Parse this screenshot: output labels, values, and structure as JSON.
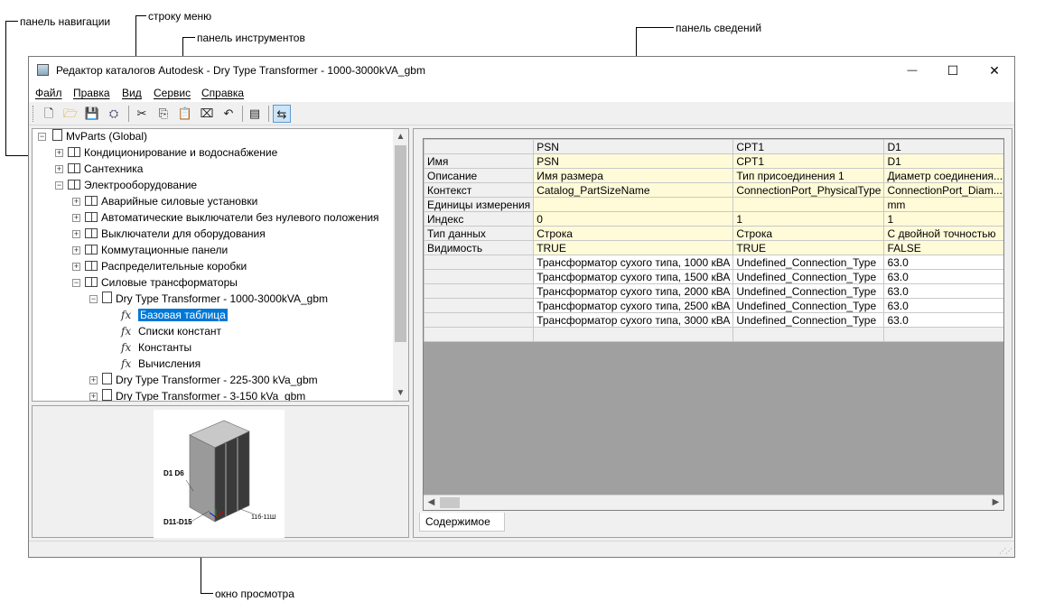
{
  "callouts": {
    "nav": "панель навигации",
    "menu": "строку меню",
    "toolbar": "панель инструментов",
    "details": "панель сведений",
    "preview": "окно просмотра"
  },
  "window": {
    "title": "Редактор каталогов Autodesk - Dry Type Transformer - 1000-3000kVA_gbm",
    "minimize": "—",
    "maximize": "☐",
    "close": "✕"
  },
  "menu": [
    "Файл",
    "Правка",
    "Вид",
    "Сервис",
    "Справка"
  ],
  "toolbar": {
    "icons": [
      "new-icon",
      "open-icon",
      "save-icon",
      "publish-icon",
      "cut-icon",
      "copy-icon",
      "paste-icon",
      "delete-icon",
      "undo-icon",
      "properties-icon",
      "validate-icon"
    ]
  },
  "tree": {
    "root": "MvParts (Global)",
    "level1": [
      "Кондиционирование и водоснабжение",
      "Сантехника",
      "Электрооборудование"
    ],
    "electrical": [
      "Аварийные силовые установки",
      "Автоматические выключатели без нулевого положения",
      "Выключатели для оборудования",
      "Коммутационные панели",
      "Распределительные коробки",
      "Силовые трансформаторы"
    ],
    "transformer": "Dry Type Transformer - 1000-3000kVA_gbm",
    "tables": [
      "Базовая таблица",
      "Списки констант",
      "Константы",
      "Вычисления"
    ],
    "others": [
      "Dry Type Transformer - 225-300 kVa_gbm",
      "Dry Type Transformer - 3-150 kVa_gbm"
    ]
  },
  "preview": {
    "label_d1": "D1 D6",
    "label_d11": "D11-D15",
    "label_right": "11б-11Ш"
  },
  "grid": {
    "columns": [
      "",
      "PSN",
      "CPT1",
      "D1"
    ],
    "header_rows": [
      [
        "Имя",
        "PSN",
        "CPT1",
        "D1"
      ],
      [
        "Описание",
        "Имя размера",
        "Тип присоединения 1",
        "Диаметр соединения..."
      ],
      [
        "Контекст",
        "Catalog_PartSizeName",
        "ConnectionPort_PhysicalType",
        "ConnectionPort_Diam..."
      ],
      [
        "Единицы измерения",
        "",
        "",
        "mm"
      ],
      [
        "Индекс",
        "0",
        "1",
        "1"
      ],
      [
        "Тип данных",
        "Строка",
        "Строка",
        "С двойной точностью"
      ],
      [
        "Видимость",
        "TRUE",
        "TRUE",
        "FALSE"
      ]
    ],
    "data_rows": [
      [
        "",
        "Трансформатор сухого типа, 1000 кВА",
        "Undefined_Connection_Type",
        "63.0"
      ],
      [
        "",
        "Трансформатор сухого типа, 1500 кВА",
        "Undefined_Connection_Type",
        "63.0"
      ],
      [
        "",
        "Трансформатор сухого типа, 2000 кВА",
        "Undefined_Connection_Type",
        "63.0"
      ],
      [
        "",
        "Трансформатор сухого типа, 2500 кВА",
        "Undefined_Connection_Type",
        "63.0"
      ],
      [
        "",
        "Трансформатор сухого типа, 3000 кВА",
        "Undefined_Connection_Type",
        "63.0"
      ],
      [
        "",
        "",
        "",
        ""
      ]
    ]
  },
  "tab": "Содержимое"
}
